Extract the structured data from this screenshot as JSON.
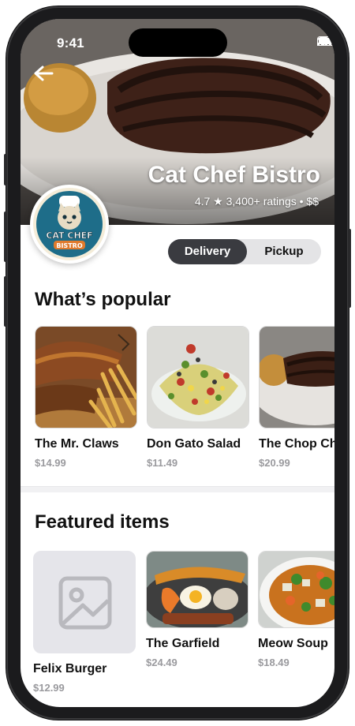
{
  "status_bar": {
    "time": "9:41"
  },
  "restaurant": {
    "name": "Cat Chef Bistro",
    "rating_text": "4.7 ★ 3,400+ ratings • $$",
    "logo_text_top": "CAT CHEF",
    "logo_text_bottom": "BISTRO"
  },
  "order_mode": {
    "options": [
      "Delivery",
      "Pickup"
    ],
    "selected": "Delivery"
  },
  "popular": {
    "title": "What’s popular",
    "items": [
      {
        "name": "The Mr. Claws",
        "price": "$14.99"
      },
      {
        "name": "Don Gato Salad",
        "price": "$11.49"
      },
      {
        "name": "The Chop Chop",
        "price": "$20.99"
      }
    ]
  },
  "featured": {
    "title": "Featured items",
    "items": [
      {
        "name": "Felix Burger",
        "price": "$12.99",
        "image": "placeholder-image-icon"
      },
      {
        "name": "The Garfield",
        "price": "$24.49"
      },
      {
        "name": "Meow Soup",
        "price": "$18.49"
      }
    ]
  },
  "colors": {
    "toggle_active": "#3a3b40",
    "toggle_track": "#e4e4e6",
    "price_grey": "#9a9a9e"
  }
}
